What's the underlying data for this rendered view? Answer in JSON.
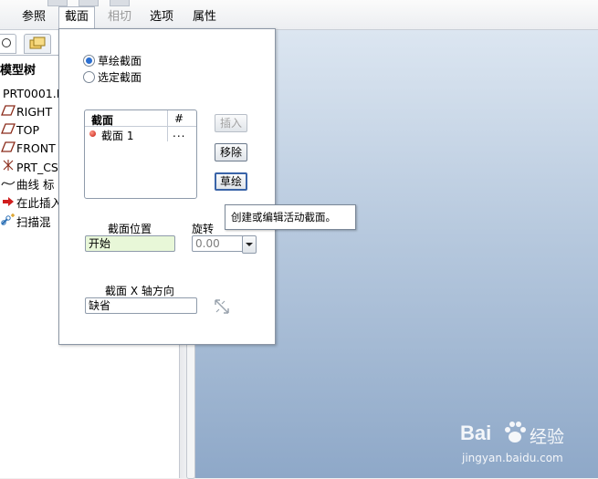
{
  "tabs": [
    {
      "label": "参照",
      "state": "normal"
    },
    {
      "label": "截面",
      "state": "active"
    },
    {
      "label": "相切",
      "state": "disabled"
    },
    {
      "label": "选项",
      "state": "normal"
    },
    {
      "label": "属性",
      "state": "normal"
    }
  ],
  "left_panel": {
    "title": "模型树",
    "items": [
      {
        "label": "PRT0001.P",
        "icon": "part-icon"
      },
      {
        "label": "RIGHT",
        "icon": "datum-plane-icon"
      },
      {
        "label": "TOP",
        "icon": "datum-plane-icon"
      },
      {
        "label": "FRONT",
        "icon": "datum-plane-icon"
      },
      {
        "label": "PRT_CS",
        "icon": "coordinate-system-icon"
      },
      {
        "label": "曲线 标",
        "icon": "curve-icon"
      },
      {
        "label": "在此插入",
        "icon": "insert-here-arrow-icon"
      },
      {
        "label": "扫描混",
        "icon": "sweep-blend-icon"
      }
    ]
  },
  "section_panel": {
    "radio_sketch": "草绘截面",
    "radio_selected": "选定截面",
    "table": {
      "col_section": "截面",
      "col_number": "#",
      "rows": [
        {
          "name": "截面 1",
          "value": "..."
        }
      ]
    },
    "btn_insert": "插入",
    "btn_remove": "移除",
    "btn_sketch": "草绘",
    "position_label": "截面位置",
    "position_value": "开始",
    "rotation_label": "旋转",
    "rotation_value": "0.00",
    "x_axis_label": "截面 X 轴方向",
    "x_axis_value": "缺省"
  },
  "tooltip": "创建或编辑活动截面。",
  "watermark": {
    "brand": "Bai",
    "brand2": "经验",
    "url": "jingyan.baidu.com"
  },
  "colors": {
    "accent": "#2b6fd1",
    "viewport_top": "#dce6f1",
    "viewport_bottom": "#8ea8c8"
  }
}
